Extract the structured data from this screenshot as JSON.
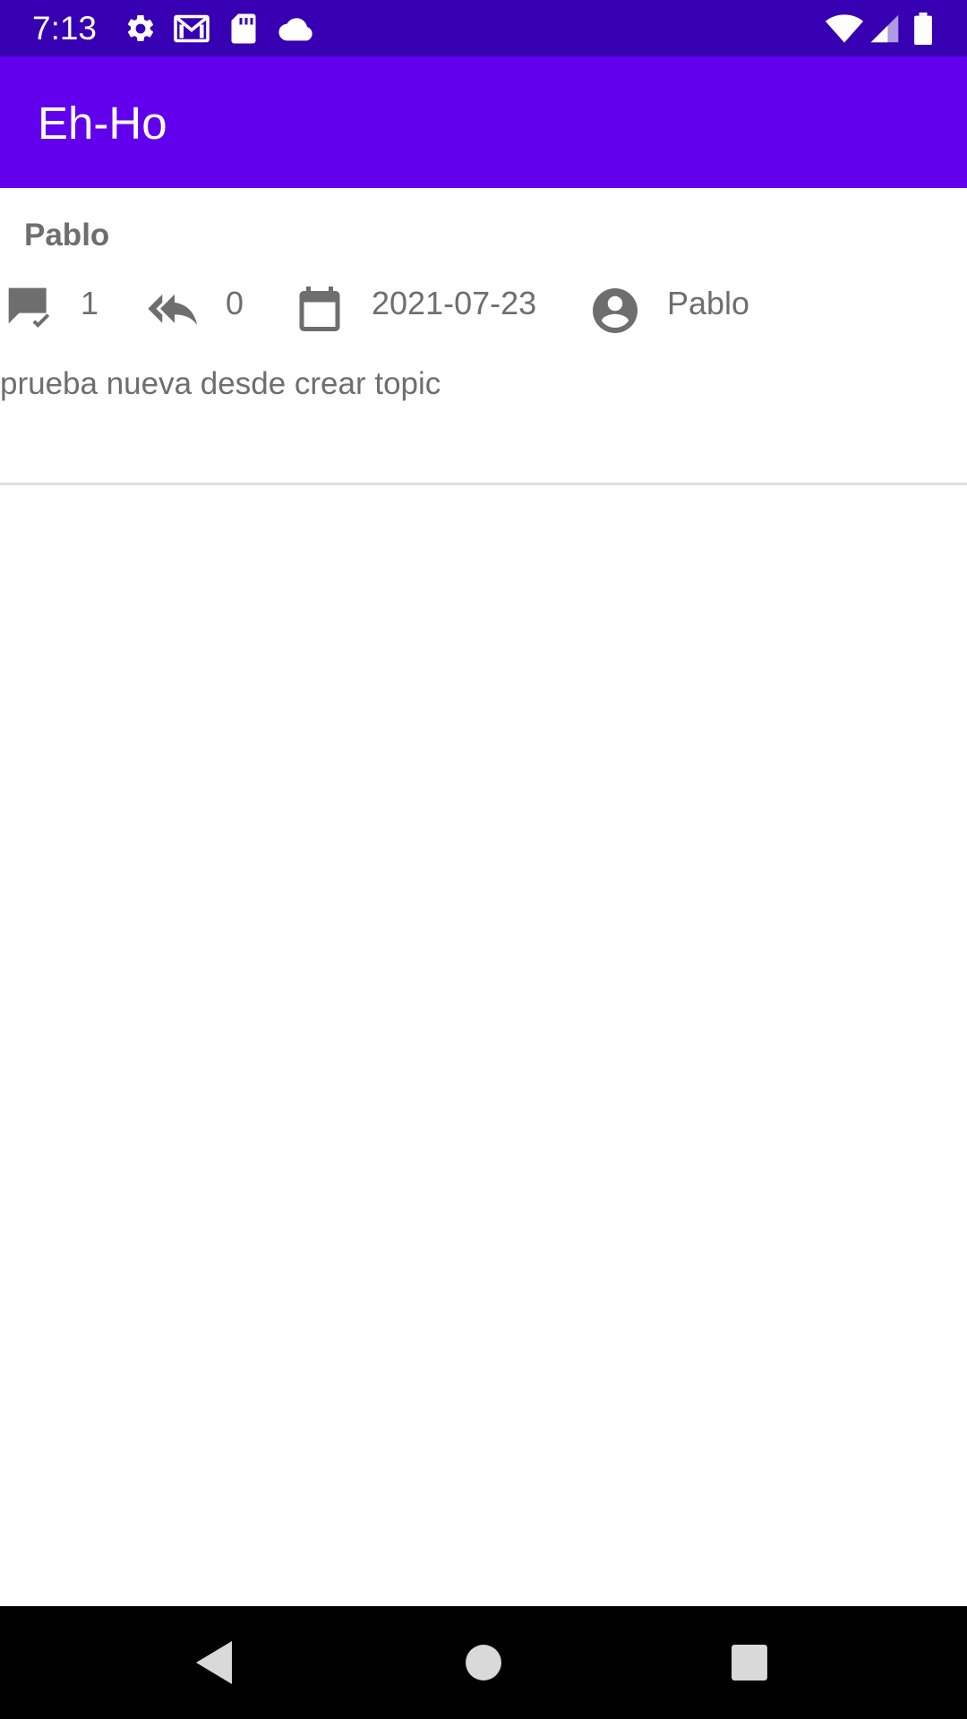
{
  "status_bar": {
    "time": "7:13",
    "left_icons": [
      "settings-icon",
      "gmail-icon",
      "sd-card-icon",
      "cloud-icon"
    ],
    "right_icons": [
      "wifi-icon",
      "cell-signal-icon",
      "battery-icon"
    ],
    "background": "#3700b3"
  },
  "app_bar": {
    "title": "Eh-Ho",
    "background": "#6200ee"
  },
  "topics": [
    {
      "title": "Pablo",
      "posts_count": "1",
      "replies_count": "0",
      "date": "2021-07-23",
      "author": "Pablo",
      "excerpt": "prueba nueva desde crear topic",
      "icons": [
        "posts-icon",
        "reply-all-icon",
        "calendar-icon",
        "account-circle-icon"
      ]
    }
  ],
  "nav_bar": {
    "buttons": [
      "back-icon",
      "home-icon",
      "recents-icon"
    ]
  }
}
